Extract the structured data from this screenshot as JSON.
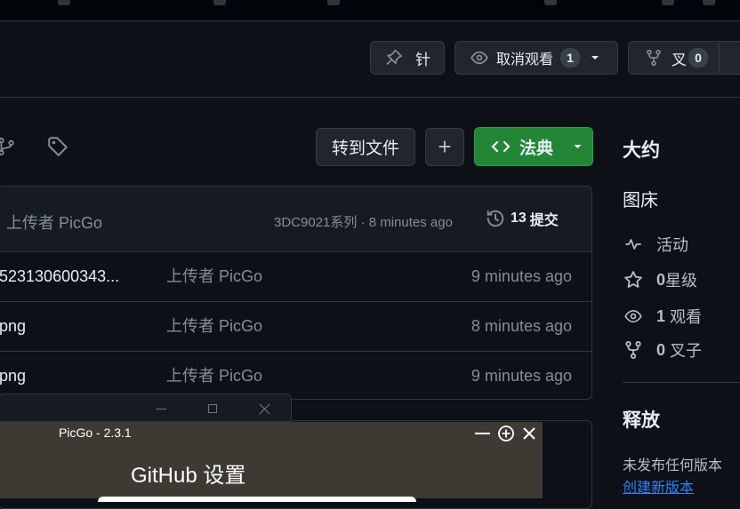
{
  "repo_actions": {
    "pin_label": "针",
    "unwatch_label": "取消观看",
    "watch_count": "1",
    "fork_label": "叉",
    "fork_count": "0"
  },
  "toolbar": {
    "goto_file_label": "转到文件",
    "add_label": "+",
    "code_label": "法典"
  },
  "latest_commit": {
    "author": "上传者 PicGo",
    "hash_text": "3DC9021系列 · 8 minutes ago",
    "commit_count": "13",
    "commits_label": "提交"
  },
  "files": [
    {
      "name": "523130600343...",
      "message": "上传者 PicGo",
      "time": "9 minutes ago"
    },
    {
      "name": "png",
      "message": "上传者 PicGo",
      "time": "8 minutes ago"
    },
    {
      "name": "png",
      "message": "上传者 PicGo",
      "time": "9 minutes ago"
    }
  ],
  "sidebar": {
    "about_title": "大约",
    "description": "图床",
    "activity_label": "活动",
    "stars_count": "0",
    "stars_label": "星级",
    "watching_count": "1",
    "watching_label": "观看",
    "forks_count": "0",
    "forks_label": "叉子",
    "releases_title": "释放",
    "no_releases": "未发布任何版本",
    "create_release": "创建新版本"
  },
  "picgo": {
    "window_title": "PicGo - 2.3.1",
    "heading": "GitHub 设置"
  },
  "colors": {
    "background": "#0d1117",
    "green_button": "#238636",
    "link": "#2f81f7",
    "dialog_bg": "#3d3a34"
  }
}
